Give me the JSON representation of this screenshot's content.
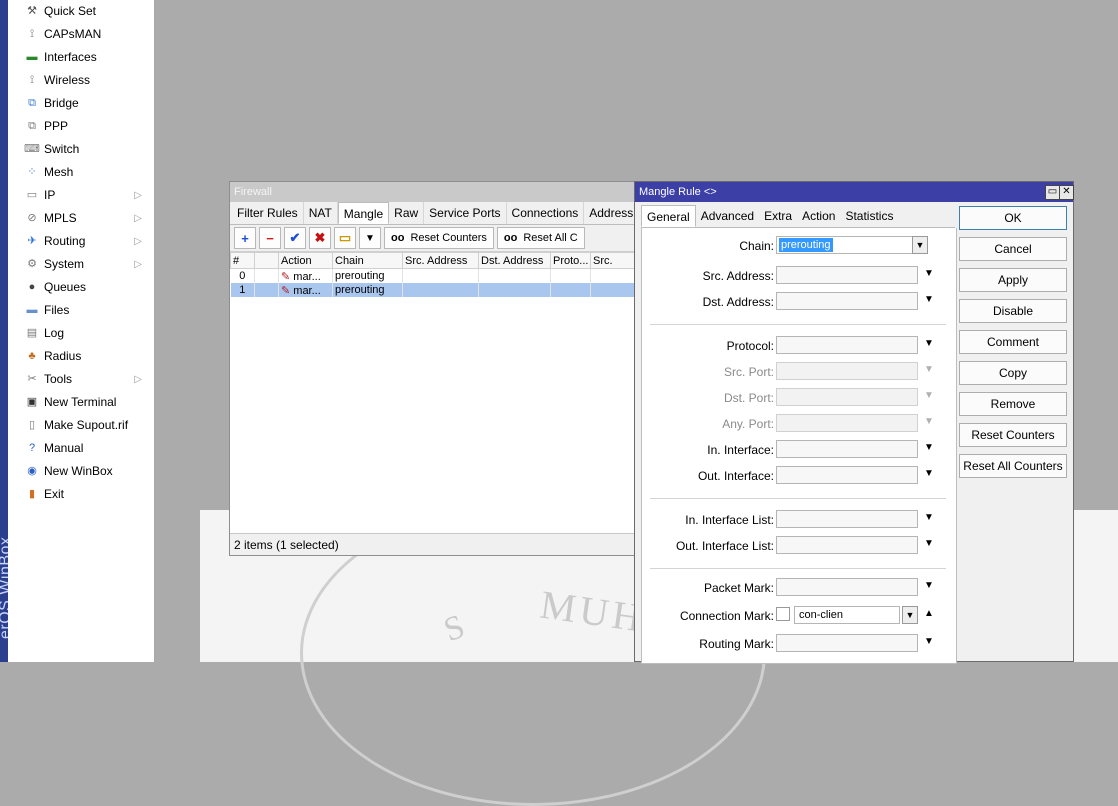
{
  "brand": {
    "vertical_text": "erOS WinBox"
  },
  "menu": {
    "items": [
      {
        "label": "Quick Set",
        "icon": "quickset-icon",
        "arrow": false
      },
      {
        "label": "CAPsMAN",
        "icon": "capsman-icon",
        "arrow": false
      },
      {
        "label": "Interfaces",
        "icon": "interfaces-icon",
        "arrow": false
      },
      {
        "label": "Wireless",
        "icon": "wireless-icon",
        "arrow": false
      },
      {
        "label": "Bridge",
        "icon": "bridge-icon",
        "arrow": false
      },
      {
        "label": "PPP",
        "icon": "ppp-icon",
        "arrow": false
      },
      {
        "label": "Switch",
        "icon": "switch-icon",
        "arrow": false
      },
      {
        "label": "Mesh",
        "icon": "mesh-icon",
        "arrow": false
      },
      {
        "label": "IP",
        "icon": "ip-icon",
        "arrow": true
      },
      {
        "label": "MPLS",
        "icon": "mpls-icon",
        "arrow": true
      },
      {
        "label": "Routing",
        "icon": "routing-icon",
        "arrow": true
      },
      {
        "label": "System",
        "icon": "system-icon",
        "arrow": true
      },
      {
        "label": "Queues",
        "icon": "queues-icon",
        "arrow": false
      },
      {
        "label": "Files",
        "icon": "files-icon",
        "arrow": false
      },
      {
        "label": "Log",
        "icon": "log-icon",
        "arrow": false
      },
      {
        "label": "Radius",
        "icon": "radius-icon",
        "arrow": false
      },
      {
        "label": "Tools",
        "icon": "tools-icon",
        "arrow": true
      },
      {
        "label": "New Terminal",
        "icon": "terminal-icon",
        "arrow": false
      },
      {
        "label": "Make Supout.rif",
        "icon": "supout-icon",
        "arrow": false
      },
      {
        "label": "Manual",
        "icon": "manual-icon",
        "arrow": false
      },
      {
        "label": "New WinBox",
        "icon": "winbox-icon",
        "arrow": false
      },
      {
        "label": "Exit",
        "icon": "exit-icon",
        "arrow": false
      }
    ]
  },
  "firewall": {
    "title": "Firewall",
    "tabs": [
      "Filter Rules",
      "NAT",
      "Mangle",
      "Raw",
      "Service Ports",
      "Connections",
      "Address"
    ],
    "active_tab": "Mangle",
    "toolbar": {
      "add": "+",
      "remove": "−",
      "enable": "✔",
      "disable": "✖",
      "comment": "▭",
      "filter": "▼",
      "reset_counters": "Reset Counters",
      "reset_all": "Reset All C",
      "oo": "oo"
    },
    "columns": [
      "#",
      "",
      "Action",
      "Chain",
      "Src. Address",
      "Dst. Address",
      "Proto...",
      "Src."
    ],
    "rows": [
      {
        "num": "0",
        "flag": "",
        "action": "mar...",
        "chain": "prerouting",
        "selected": false
      },
      {
        "num": "1",
        "flag": "",
        "action": "mar...",
        "chain": "prerouting",
        "selected": true
      }
    ],
    "status": "2 items (1 selected)"
  },
  "mangle_rule": {
    "title": "Mangle Rule <>",
    "tabs": [
      "General",
      "Advanced",
      "Extra",
      "Action",
      "Statistics"
    ],
    "active_tab": "General",
    "chain": {
      "label": "Chain:",
      "value": "prerouting"
    },
    "fields_a": [
      {
        "label": "Src. Address:",
        "disabled": false
      },
      {
        "label": "Dst. Address:",
        "disabled": false
      }
    ],
    "fields_b": [
      {
        "label": "Protocol:",
        "disabled": false
      },
      {
        "label": "Src. Port:",
        "disabled": true
      },
      {
        "label": "Dst. Port:",
        "disabled": true
      },
      {
        "label": "Any. Port:",
        "disabled": true
      },
      {
        "label": "In. Interface:",
        "disabled": false
      },
      {
        "label": "Out. Interface:",
        "disabled": false
      }
    ],
    "fields_c": [
      {
        "label": "In. Interface List:",
        "disabled": false
      },
      {
        "label": "Out. Interface List:",
        "disabled": false
      }
    ],
    "packet_mark": {
      "label": "Packet Mark:"
    },
    "connection_mark": {
      "label": "Connection Mark:",
      "value": "con-clien"
    },
    "routing_mark": {
      "label": "Routing Mark:"
    },
    "buttons": [
      "OK",
      "Cancel",
      "Apply",
      "Disable",
      "Comment",
      "Copy",
      "Remove",
      "Reset Counters",
      "Reset All Counters"
    ]
  },
  "watermark": {
    "text": "MUHA",
    "fragment": "S"
  }
}
